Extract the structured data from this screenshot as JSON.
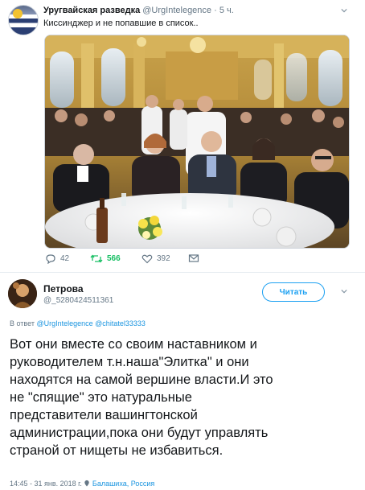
{
  "tweet1": {
    "author_name": "Уругвайская разведка",
    "author_handle": "@UrgIntelegence",
    "separator": "·",
    "time": "5 ч.",
    "text": "Киссинджер и не попавшие в список..",
    "stats": {
      "replies": "42",
      "retweets": "566",
      "likes": "392"
    }
  },
  "tweet2": {
    "author_name": "Петрова",
    "author_handle": "@_5280424511361",
    "follow_label": "Читать",
    "reply_prefix": "В ответ",
    "reply_to": [
      "@UrgIntelegence",
      "@chitatel33333"
    ],
    "text": "Вот они вместе со своим наставником и\nруководителем т.н.наша\"Элитка\" и они\nнаходятся на самой вершине власти.И это\nне \"спящие\" это натуральные\nпредставители вашингтонской\nадминистрации,пока они будут управлять\nстраной от нищеты не избавиться.",
    "timestamp": "14:45 - 31 янв. 2018 г.",
    "location": "Балашиха, Россия"
  },
  "colors": {
    "accent": "#1da1f2",
    "retweet": "#17bf63",
    "muted": "#657786"
  }
}
